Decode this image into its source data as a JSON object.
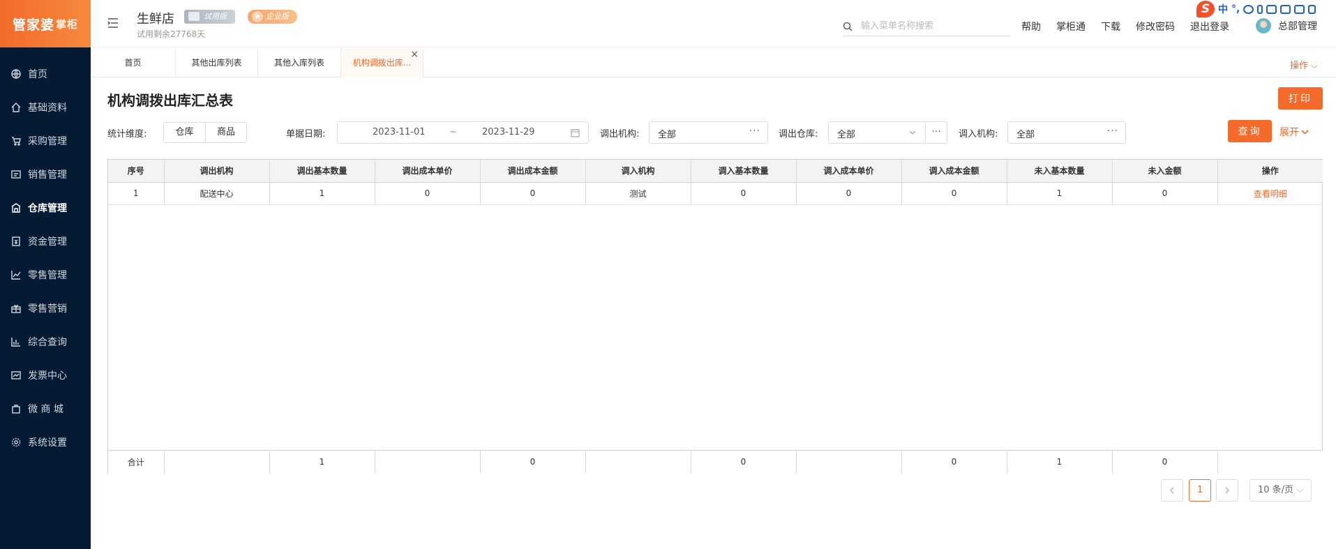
{
  "app": {
    "logo_main": "管家婆",
    "logo_sub": "掌柜",
    "store_name": "生鲜店",
    "trial_badge": "试用版",
    "edition_badge": "企业版",
    "trial_days": "试用剩余27768天"
  },
  "sidebar": {
    "items": [
      {
        "label": "首页",
        "icon": "globe-icon"
      },
      {
        "label": "基础资料",
        "icon": "home-icon"
      },
      {
        "label": "采购管理",
        "icon": "cart-icon"
      },
      {
        "label": "销售管理",
        "icon": "sales-icon"
      },
      {
        "label": "仓库管理",
        "icon": "warehouse-icon",
        "active": true
      },
      {
        "label": "资金管理",
        "icon": "money-icon"
      },
      {
        "label": "零售管理",
        "icon": "chart-icon"
      },
      {
        "label": "零售营销",
        "icon": "gift-icon"
      },
      {
        "label": "综合查询",
        "icon": "bar-chart-icon"
      },
      {
        "label": "发票中心",
        "icon": "invoice-icon"
      },
      {
        "label": "微 商 城",
        "icon": "bag-icon"
      },
      {
        "label": "系统设置",
        "icon": "gear-icon"
      }
    ]
  },
  "header": {
    "search_placeholder": "输入菜单名称搜索",
    "links": [
      "帮助",
      "掌柜通",
      "下载",
      "修改密码",
      "退出登录"
    ],
    "user_name": "总部管理"
  },
  "ime": {
    "logo": "S",
    "mode": "中",
    "punct": "°,"
  },
  "tabs": {
    "items": [
      "首页",
      "其他出库列表",
      "其他入库列表",
      "机构调拨出库..."
    ],
    "active_index": 3,
    "close_symbol": "×",
    "ops_label": "操作"
  },
  "page": {
    "title": "机构调拨出库汇总表",
    "print_label": "打印"
  },
  "filters": {
    "dimension_label": "统计维度:",
    "dimension_options": [
      "仓库",
      "商品"
    ],
    "date_label": "单据日期:",
    "date_start": "2023-11-01",
    "date_sep": "~",
    "date_end": "2023-11-29",
    "out_org_label": "调出机构:",
    "out_org_value": "全部",
    "out_wh_label": "调出仓库:",
    "out_wh_value": "全部",
    "in_org_label": "调入机构:",
    "in_org_value": "全部",
    "more_symbol": "···",
    "query_label": "查询",
    "expand_label": "展开"
  },
  "table": {
    "columns": [
      "序号",
      "调出机构",
      "调出基本数量",
      "调出成本单价",
      "调出成本金额",
      "调入机构",
      "调入基本数量",
      "调入成本单价",
      "调入成本金额",
      "未入基本数量",
      "未入金额",
      "操作"
    ],
    "rows": [
      [
        "1",
        "配送中心",
        "1",
        "0",
        "0",
        "测试",
        "0",
        "0",
        "0",
        "1",
        "0",
        "查看明细"
      ]
    ],
    "totals": [
      "合计",
      "",
      "1",
      "",
      "0",
      "",
      "0",
      "",
      "0",
      "1",
      "0",
      ""
    ]
  },
  "pagination": {
    "current_page": "1",
    "page_size": "10 条/页"
  },
  "colors": {
    "accent": "#f36a2b",
    "sidebar_bg": "#051b33"
  }
}
